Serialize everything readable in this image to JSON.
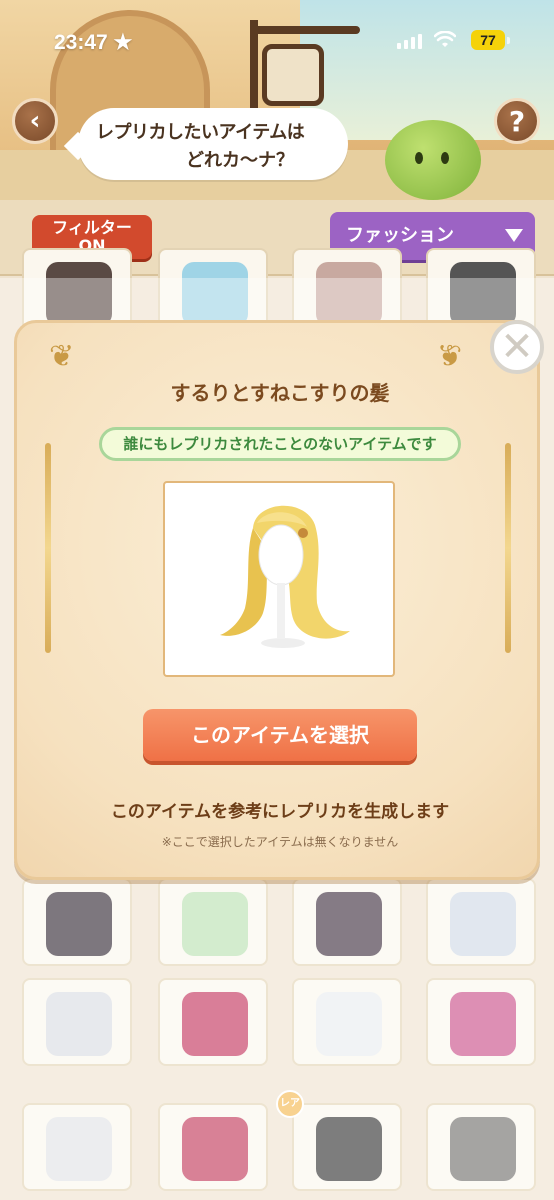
{
  "status_bar": {
    "time": "23:47 ★",
    "battery": "77"
  },
  "header": {
    "prompt_line1": "レプリカしたいアイテムは",
    "prompt_line2": "どれカ～ナ？",
    "back_icon": "chevron-left-icon",
    "help_label": "?"
  },
  "filters": {
    "filter_label_line1": "フィルター",
    "filter_label_line2": "ON",
    "category_selected": "ファッション"
  },
  "modal": {
    "item_name": "するりとすねこすりの髪",
    "note": "誰にもレプリカされたことのないアイテムです",
    "select_button": "このアイテムを選択",
    "description": "このアイテムを参考にレプリカを生成します",
    "footnote": "※ここで選択したアイテムは無くなりません",
    "close_icon": "close-icon"
  },
  "grid": {
    "rare_label": "レア",
    "tiles": [
      {
        "color": "#5a4a44"
      },
      {
        "color": "#9fd4e6"
      },
      {
        "color": "#c8a9a0"
      },
      {
        "color": "#555555"
      },
      {
        "color": "#2e2530"
      },
      {
        "color": "#b8e0b0"
      },
      {
        "color": "#3a2a3a"
      },
      {
        "color": "#cfd9e6"
      },
      {
        "color": "#d8dce2"
      },
      {
        "color": "#c2305a"
      },
      {
        "color": "#e9ecef"
      },
      {
        "color": "#c94b86"
      },
      {
        "color": "#e0e2e6"
      },
      {
        "color": "#c03456"
      },
      {
        "color": "#2e2e2e"
      },
      {
        "color": "#6f6c6a"
      }
    ]
  }
}
